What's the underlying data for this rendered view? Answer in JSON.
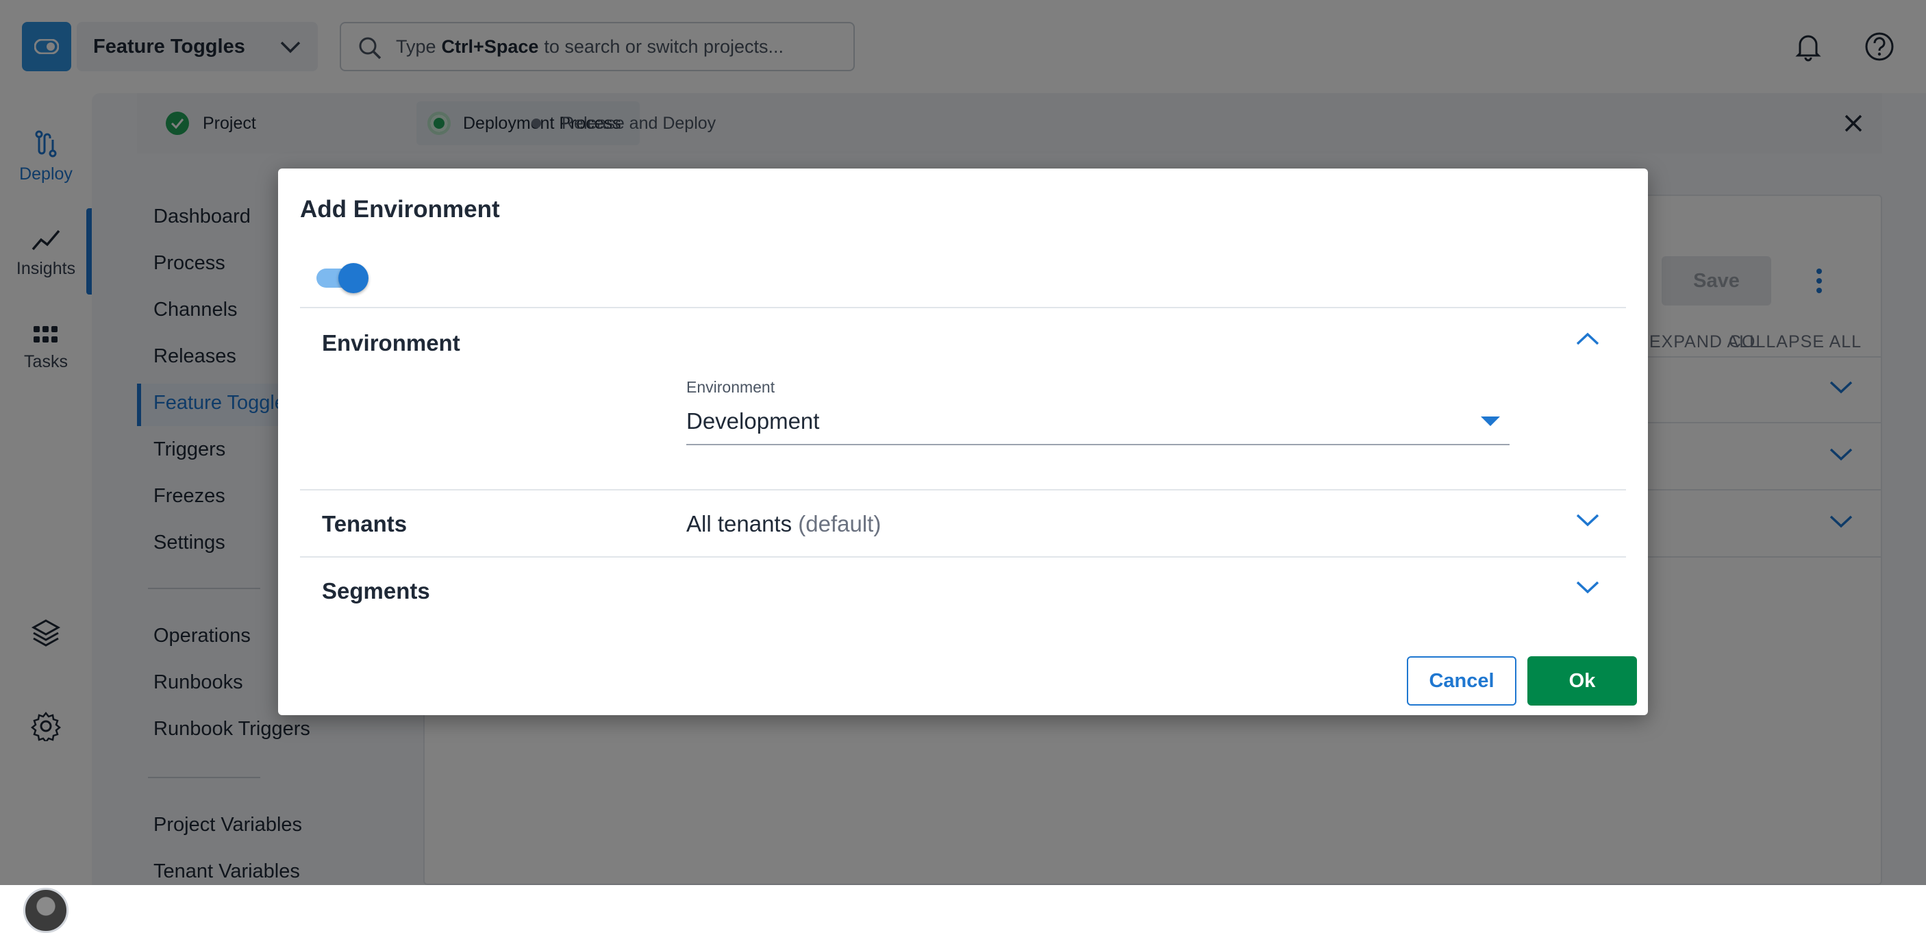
{
  "topbar": {
    "project_name": "Feature Toggles",
    "search_prefix": "Type",
    "search_shortcut": "Ctrl+Space",
    "search_suffix": "to search or switch projects..."
  },
  "rail": {
    "items": [
      {
        "label": "Deploy",
        "icon": "deploy-icon"
      },
      {
        "label": "Insights",
        "icon": "insights-icon"
      },
      {
        "label": "Tasks",
        "icon": "tasks-icon"
      }
    ]
  },
  "steps": [
    {
      "label": "Project",
      "state": "complete"
    },
    {
      "label": "Deployment Process",
      "state": "current"
    },
    {
      "label": "Release and Deploy",
      "state": "pending"
    }
  ],
  "subnav": {
    "items": [
      "Dashboard",
      "Process",
      "Channels",
      "Releases",
      "Feature Toggles",
      "Triggers",
      "Freezes",
      "Settings"
    ],
    "operations": [
      "Operations",
      "Runbooks",
      "Runbook Triggers"
    ],
    "variables": [
      "Project Variables",
      "Tenant Variables"
    ]
  },
  "panel": {
    "save_label": "Save",
    "expand_all": "EXPAND ALL",
    "collapse_all": "COLLAPSE ALL"
  },
  "modal": {
    "title": "Add Environment",
    "toggle_on": true,
    "environment_section": "Environment",
    "environment_field_label": "Environment",
    "environment_value": "Development",
    "tenants_section": "Tenants",
    "tenants_value": "All tenants",
    "tenants_default": "(default)",
    "segments_section": "Segments",
    "cancel_label": "Cancel",
    "ok_label": "Ok"
  },
  "colors": {
    "accent": "#1f77d0",
    "ok_green": "#00874a",
    "step_green": "#22a55b"
  }
}
